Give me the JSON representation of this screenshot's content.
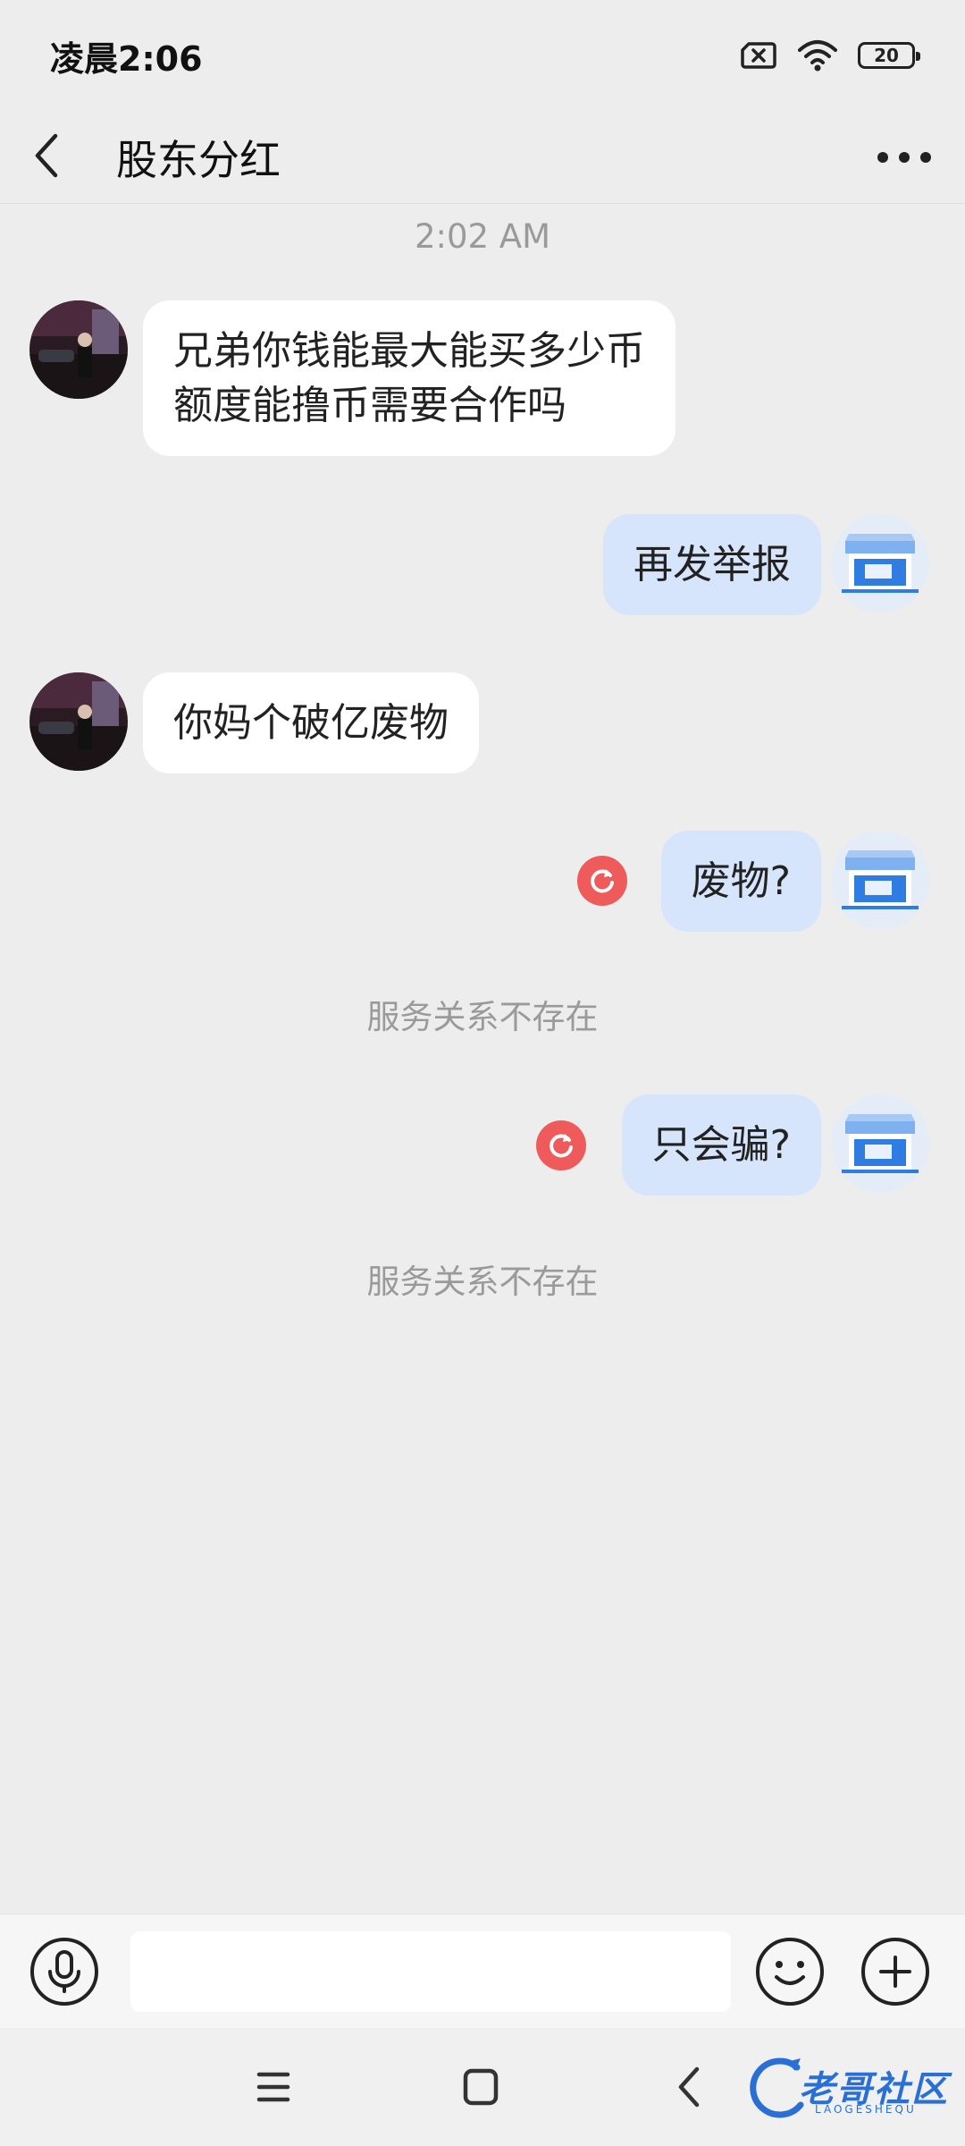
{
  "status_bar": {
    "time": "凌晨2:06",
    "battery": "20",
    "icons": [
      "sim-off-icon",
      "wifi-icon",
      "battery-icon"
    ]
  },
  "header": {
    "back_icon": "chevron-left-icon",
    "title": "股东分红",
    "more_icon": "more-dots-icon"
  },
  "chat": {
    "timestamp": "2:02 AM",
    "messages": [
      {
        "from": "other",
        "text_line1": "兄弟你钱能最大能买多少币",
        "text_line2": "额度能撸币需要合作吗"
      },
      {
        "from": "me",
        "text": "再发举报"
      },
      {
        "from": "other",
        "text": "你妈个破亿废物"
      },
      {
        "from": "me",
        "text": "废物?",
        "status": "failed-resend"
      },
      {
        "from": "system",
        "text": "服务关系不存在"
      },
      {
        "from": "me",
        "text": "只会骗?",
        "status": "failed-resend"
      },
      {
        "from": "system",
        "text": "服务关系不存在"
      }
    ]
  },
  "input_bar": {
    "voice_icon": "microphone-icon",
    "input_value": "",
    "input_placeholder": "",
    "emoji_icon": "smile-icon",
    "plus_icon": "plus-circle-icon"
  },
  "nav_bar": {
    "icons": [
      "menu-icon",
      "home-square-icon",
      "back-icon"
    ]
  },
  "watermark": {
    "text": "老哥社区",
    "sub": "LAOGESHEQU"
  },
  "colors": {
    "background": "#ededed",
    "incoming_bubble": "#ffffff",
    "outgoing_bubble": "#d6e5fb",
    "resend_red": "#ef5b5b",
    "store_blue": "#2f7de1"
  }
}
